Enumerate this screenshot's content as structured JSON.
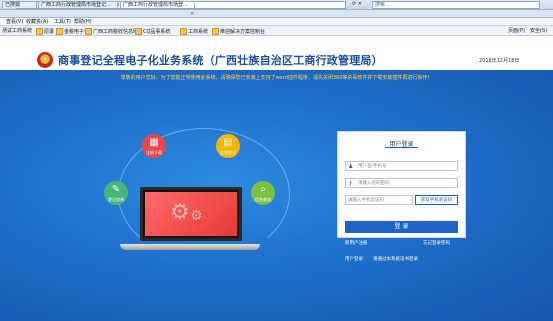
{
  "browser": {
    "address": "https://121.31.62.56:2011/.../CPSP/loginaction",
    "search_placeholder": "搜索...",
    "tabs": [
      {
        "label": "已搜狐"
      },
      {
        "label": "广西工商行政管理局市场登记..."
      },
      {
        "label": "广西工商行政管理局市场登..."
      }
    ],
    "menu": [
      "查看(V)",
      "收藏夹(A)",
      "工具(T)",
      "帮助(H)"
    ],
    "favorites": [
      "测试工商系统",
      "原录",
      "金税电子化",
      "广西工商税收信息网",
      "CQ品事系统",
      "工商系统",
      "难迎解决方案控制台"
    ],
    "toolbar_right": [
      "页面(P)",
      "安全(S)"
    ]
  },
  "page": {
    "site_title": "商事登记全程电子化业务系统（广西壮族自治区工商行政管理局）",
    "date": "2018年12月18日",
    "notice": "尊敬的用户您好，为了您能正常使用此系统，请确保您已安装上支持了word插件程序，请先关闭360等杀毒软件并下载安装插件再进行操作！"
  },
  "features": [
    {
      "label": "注册下载",
      "glyph": "▦",
      "color": "#e8474b"
    },
    {
      "label": "名称登记",
      "glyph": "▤",
      "color": "#f4b400"
    },
    {
      "label": "登记咨询",
      "glyph": "✎",
      "color": "#43b77a"
    },
    {
      "label": "信息查询",
      "glyph": "⌕",
      "color": "#7cc043"
    }
  ],
  "login": {
    "title": "用户登录",
    "username_placeholder": "用户名/手机号",
    "password_placeholder": "请输入您的密码",
    "code_placeholder": "请输入手机验证码",
    "code_button": "获取手机验证码",
    "submit": "登 录",
    "register_link": "新用户注册",
    "forgot_link": "忘记登录密码",
    "user_login_label": "用户登录：",
    "user_login_hint": "请通过本系统证书登录"
  }
}
